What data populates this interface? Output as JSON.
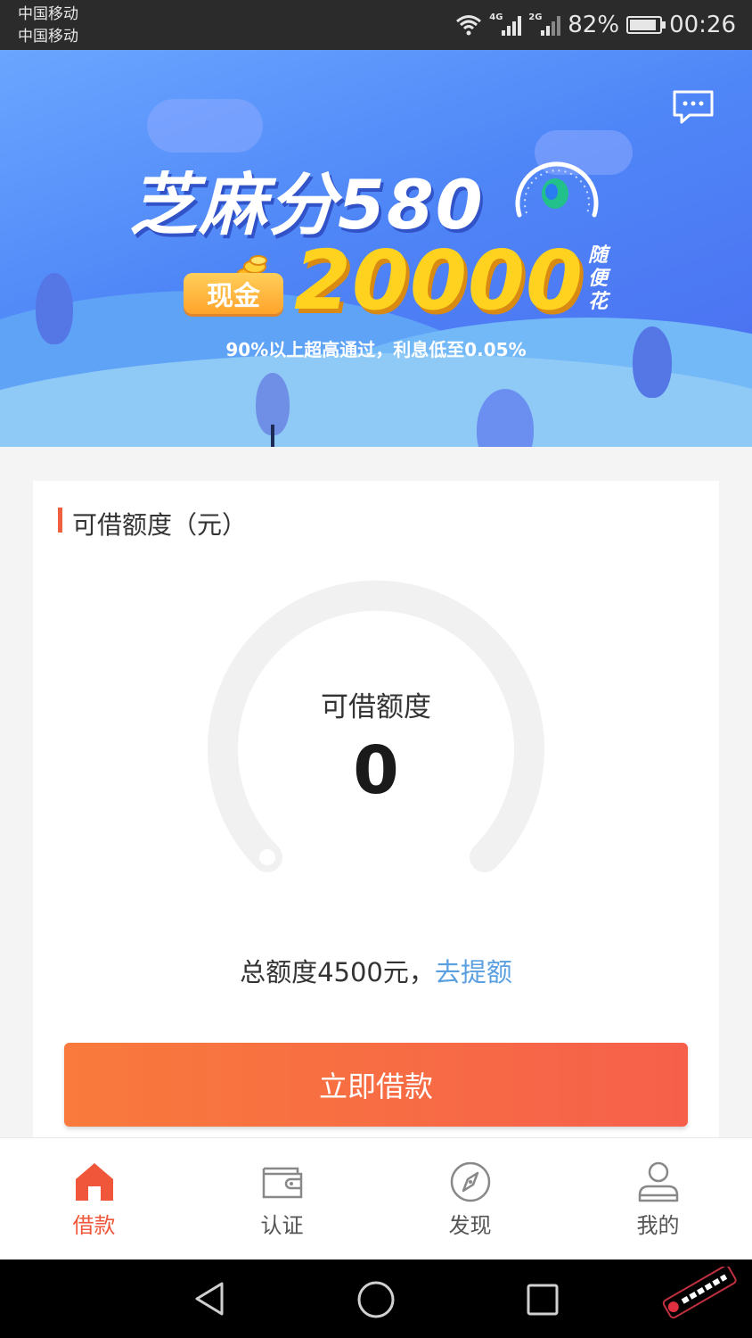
{
  "status_bar": {
    "carrier_1": "中国移动",
    "carrier_2": "中国移动",
    "sim1_net": "4G",
    "sim2_net": "2G",
    "battery": "82%",
    "time": "00:26"
  },
  "banner": {
    "headline": "芝麻分580",
    "cash_label": "现金",
    "amount": "20000",
    "side_text": "随便花",
    "subline": "90%以上超高通过，利息低至0.05%"
  },
  "card": {
    "title": "可借额度（元）",
    "ring_label": "可借额度",
    "available_amount": "0",
    "available_fraction": 0,
    "total_text": "总额度4500元，",
    "raise_link": "去提额",
    "borrow_button": "立即借款"
  },
  "bottom_nav": {
    "items": [
      {
        "label": "借款",
        "icon": "home-icon",
        "active": true
      },
      {
        "label": "认证",
        "icon": "wallet-icon",
        "active": false
      },
      {
        "label": "发现",
        "icon": "compass-icon",
        "active": false
      },
      {
        "label": "我的",
        "icon": "user-icon",
        "active": false
      }
    ]
  },
  "colors": {
    "accent": "#f0563a",
    "button_start": "#f97a3c",
    "button_end": "#f6604b",
    "link": "#5a9fe0",
    "banner_blue": "#4f86f7",
    "gold": "#ffd21f"
  }
}
